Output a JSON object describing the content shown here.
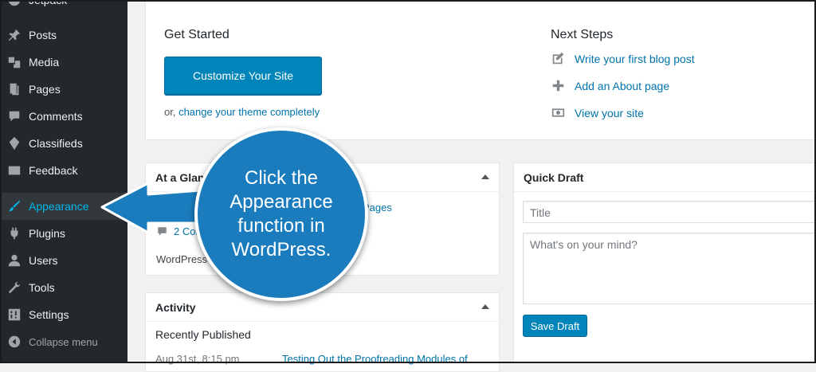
{
  "sidebar": {
    "items": [
      {
        "label": "Jetpack",
        "icon": "jetpack-icon"
      },
      {
        "label": "Posts",
        "icon": "pin-icon"
      },
      {
        "label": "Media",
        "icon": "media-icon"
      },
      {
        "label": "Pages",
        "icon": "pages-icon"
      },
      {
        "label": "Comments",
        "icon": "comments-icon"
      },
      {
        "label": "Classifieds",
        "icon": "classifieds-icon"
      },
      {
        "label": "Feedback",
        "icon": "feedback-icon"
      },
      {
        "label": "Appearance",
        "icon": "brush-icon",
        "active": true
      },
      {
        "label": "Plugins",
        "icon": "plug-icon"
      },
      {
        "label": "Users",
        "icon": "user-icon"
      },
      {
        "label": "Tools",
        "icon": "wrench-icon"
      },
      {
        "label": "Settings",
        "icon": "settings-icon"
      },
      {
        "label": "Collapse menu",
        "icon": "collapse-icon"
      }
    ]
  },
  "welcome": {
    "get_started": "Get Started",
    "customize_button": "Customize Your Site",
    "or_text": "or, ",
    "change_theme_link": "change your theme completely",
    "next_steps": "Next Steps",
    "steps": [
      {
        "label": "Write your first blog post",
        "icon": "edit-icon"
      },
      {
        "label": "Add an About page",
        "icon": "plus-icon"
      },
      {
        "label": "View your site",
        "icon": "view-icon"
      }
    ]
  },
  "glance": {
    "title": "At a Glance",
    "pages_link": "Pages",
    "comments_link": "2 Comments",
    "wp_text": "WordPress 4.8.2 running theme."
  },
  "activity": {
    "title": "Activity",
    "recently_published": "Recently Published",
    "row_date": "Aug 31st, 8:15 pm",
    "row_link": "Testing Out the Proofreading Modules of"
  },
  "quick_draft": {
    "title": "Quick Draft",
    "title_placeholder": "Title",
    "content_placeholder": "What's on your mind?",
    "save_button": "Save Draft"
  },
  "callout": {
    "text": "Click the Appearance function in WordPress."
  },
  "colors": {
    "sidebar_bg": "#23282d",
    "accent": "#00b9eb",
    "button_blue": "#0085ba",
    "callout_blue": "#1a7cbd"
  }
}
